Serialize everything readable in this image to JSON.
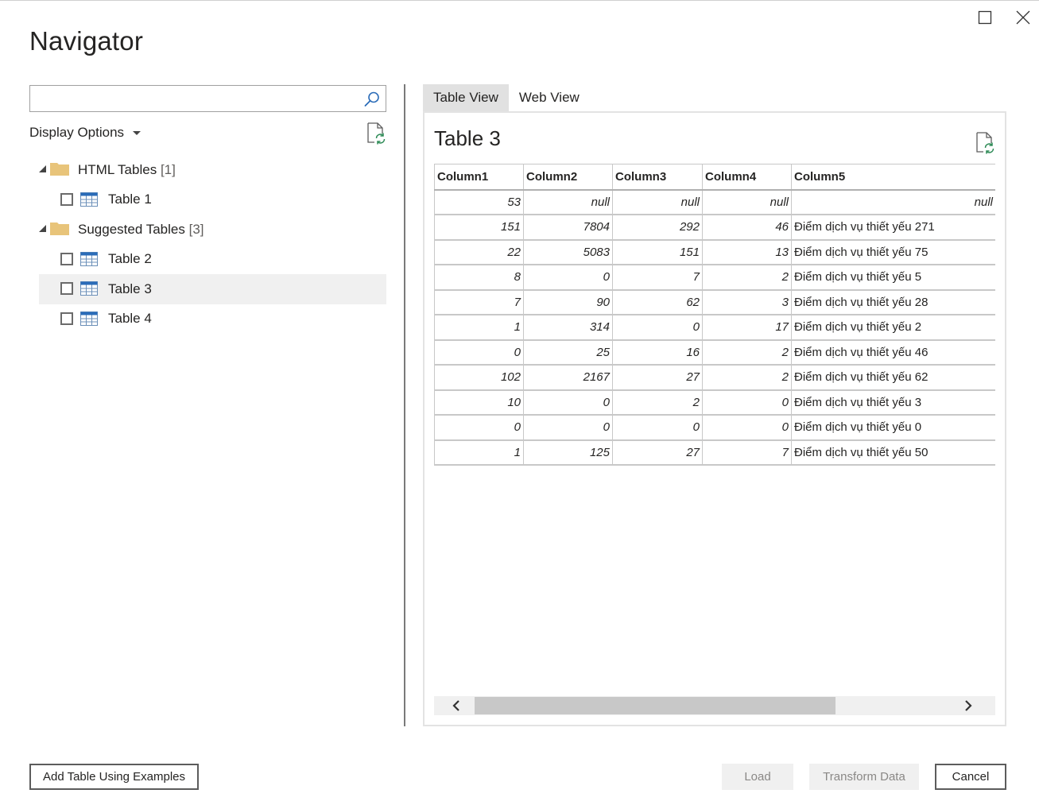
{
  "window": {
    "title": "Navigator"
  },
  "search": {
    "value": "",
    "placeholder": ""
  },
  "display_options": {
    "label": "Display Options"
  },
  "tree": {
    "groups": [
      {
        "label": "HTML Tables",
        "count": "[1]",
        "items": [
          {
            "label": "Table 1",
            "checked": false,
            "selected": false
          }
        ]
      },
      {
        "label": "Suggested Tables",
        "count": "[3]",
        "items": [
          {
            "label": "Table 2",
            "checked": false,
            "selected": false
          },
          {
            "label": "Table 3",
            "checked": false,
            "selected": true
          },
          {
            "label": "Table 4",
            "checked": false,
            "selected": false
          }
        ]
      }
    ]
  },
  "tabs": [
    {
      "label": "Table View",
      "active": true
    },
    {
      "label": "Web View",
      "active": false
    }
  ],
  "preview": {
    "title": "Table 3",
    "columns": [
      "Column1",
      "Column2",
      "Column3",
      "Column4",
      "Column5"
    ],
    "rows": [
      [
        "53",
        "null",
        "null",
        "null",
        "null"
      ],
      [
        "151",
        "7804",
        "292",
        "46",
        "Điểm dịch vụ thiết yếu 271"
      ],
      [
        "22",
        "5083",
        "151",
        "13",
        "Điểm dịch vụ thiết yếu 75"
      ],
      [
        "8",
        "0",
        "7",
        "2",
        "Điểm dịch vụ thiết yếu 5"
      ],
      [
        "7",
        "90",
        "62",
        "3",
        "Điểm dịch vụ thiết yếu 28"
      ],
      [
        "1",
        "314",
        "0",
        "17",
        "Điểm dịch vụ thiết yếu 2"
      ],
      [
        "0",
        "25",
        "16",
        "2",
        "Điểm dịch vụ thiết yếu 46"
      ],
      [
        "102",
        "2167",
        "27",
        "2",
        "Điểm dịch vụ thiết yếu 62"
      ],
      [
        "10",
        "0",
        "2",
        "0",
        "Điểm dịch vụ thiết yếu 3"
      ],
      [
        "0",
        "0",
        "0",
        "0",
        "Điểm dịch vụ thiết yếu 0"
      ],
      [
        "1",
        "125",
        "27",
        "7",
        "Điểm dịch vụ thiết yếu 50"
      ]
    ],
    "scroll_position": 0.64
  },
  "buttons": {
    "add_table": "Add Table Using Examples",
    "load": "Load",
    "transform": "Transform Data",
    "cancel": "Cancel"
  },
  "icons": {
    "search": "search-icon",
    "refresh": "refresh-icon",
    "folder": "folder-icon",
    "table": "table-icon",
    "maximize": "maximize-icon",
    "close": "close-icon"
  },
  "colors": {
    "folder": "#e8c47a",
    "table_icon": "#2b6cb8",
    "selected_row": "#f0f0f0",
    "active_tab": "#e1e1e1"
  }
}
